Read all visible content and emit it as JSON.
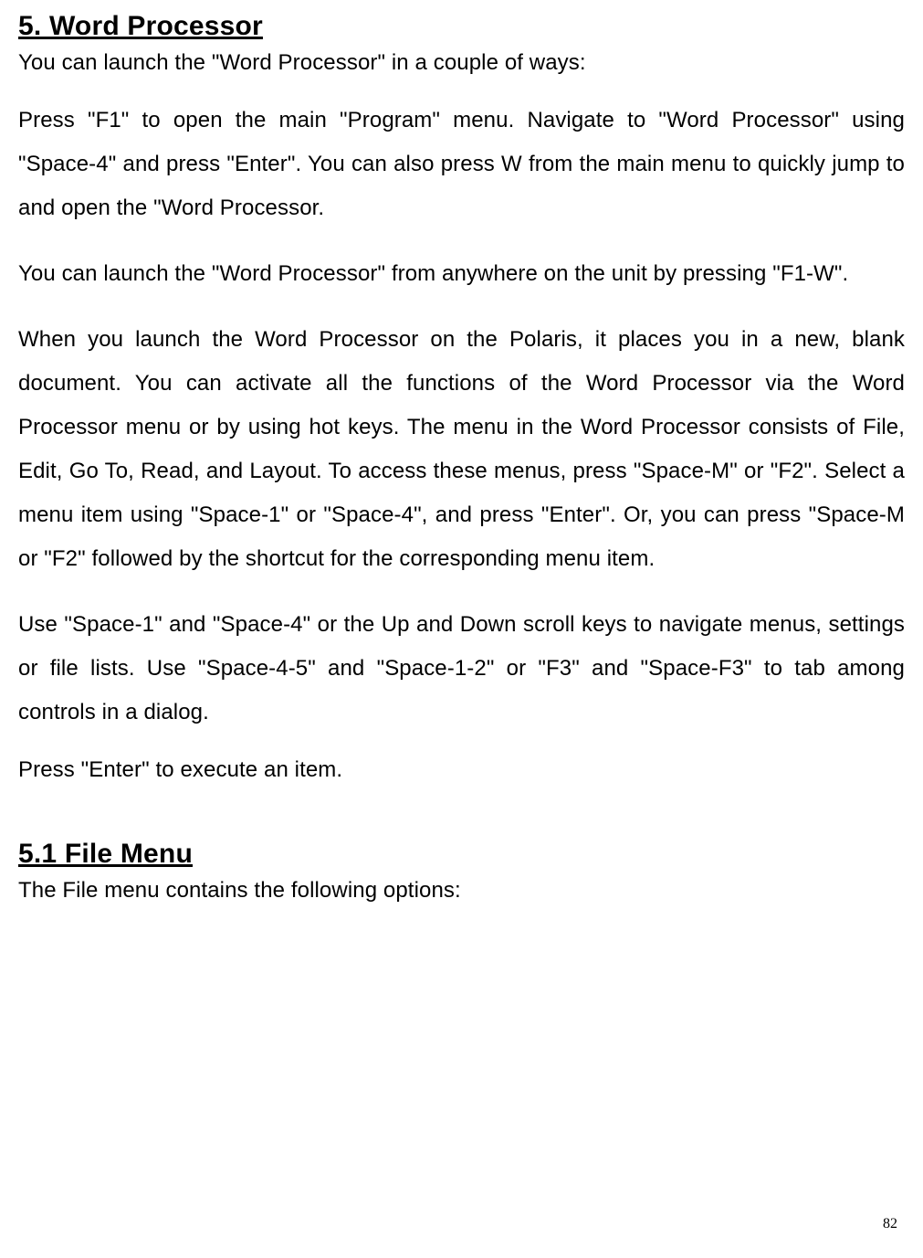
{
  "headings": {
    "h1": "5. Word Processor",
    "h2": "5.1 File Menu"
  },
  "paragraphs": {
    "p1": "You can launch the \"Word Processor\" in a couple of ways:",
    "p2": "Press \"F1\" to open the main \"Program\" menu. Navigate to \"Word Processor\" using \"Space-4\" and press \"Enter\". You can also press W from the main menu to quickly jump to and open the \"Word Processor.",
    "p3": "You can launch the \"Word Processor\" from anywhere on the unit by pressing \"F1-W\".",
    "p4": "When you launch the Word Processor on the Polaris, it places you in a new, blank document. You can activate all the functions of the Word Processor via the Word Processor menu or by using hot keys. The menu in the Word Processor consists of File, Edit, Go To, Read, and Layout. To access these menus, press \"Space-M\" or \"F2\". Select a menu item using \"Space-1\" or \"Space-4\", and press \"Enter\". Or, you can press \"Space-M or \"F2\" followed by the shortcut for the corresponding menu item.",
    "p5": "Use \"Space-1\" and \"Space-4\" or the Up and Down scroll keys to navigate menus, settings or file lists. Use \"Space-4-5\" and \"Space-1-2\" or \"F3\" and \"Space-F3\" to tab among controls in a dialog.",
    "p6": "Press \"Enter\" to execute an item.",
    "p7": "The File menu contains the following options:"
  },
  "page_number": "82"
}
